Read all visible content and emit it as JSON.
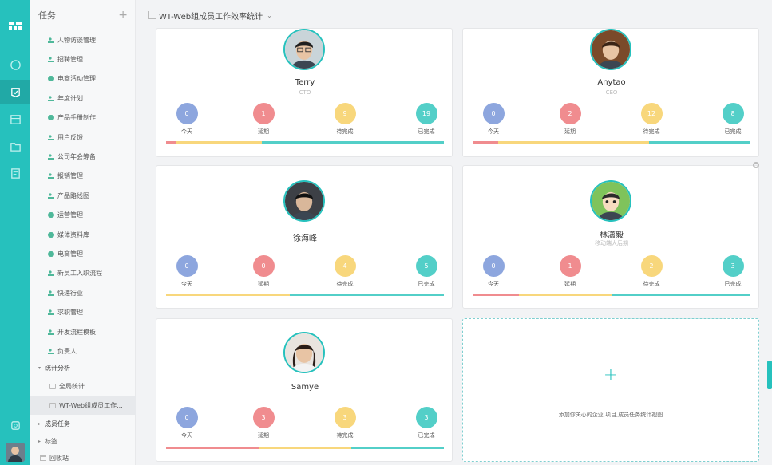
{
  "sidebar": {
    "header": "任务",
    "add": "+",
    "items": [
      {
        "label": "人物访谈管理",
        "icon": "people"
      },
      {
        "label": "招聘管理",
        "icon": "people"
      },
      {
        "label": "电商活动管理",
        "icon": "cloud"
      },
      {
        "label": "年度计划",
        "icon": "people"
      },
      {
        "label": "产品手册制作",
        "icon": "cloud"
      },
      {
        "label": "用户反馈",
        "icon": "people"
      },
      {
        "label": "公司年会筹备",
        "icon": "people"
      },
      {
        "label": "报销管理",
        "icon": "people"
      },
      {
        "label": "产品路线图",
        "icon": "people"
      },
      {
        "label": "运营管理",
        "icon": "cloud"
      },
      {
        "label": "媒体资料库",
        "icon": "cloud"
      },
      {
        "label": "电商管理",
        "icon": "cloud"
      },
      {
        "label": "新员工入职流程",
        "icon": "people"
      },
      {
        "label": "快递行业",
        "icon": "people"
      },
      {
        "label": "求职管理",
        "icon": "people"
      },
      {
        "label": "开发流程模板",
        "icon": "people"
      },
      {
        "label": "负责人",
        "icon": "people"
      }
    ],
    "stats_group": "统计分析",
    "stats_items": [
      "全局统计",
      "WT-Web组成员工作..."
    ],
    "member_tasks": "成员任务",
    "tags": "标签",
    "trash": "回收站"
  },
  "header": {
    "title": "WT-Web组成员工作效率统计",
    "chevron": "⌄"
  },
  "stat_labels": {
    "today": "今天",
    "overdue": "延期",
    "pending": "待完成",
    "done": "已完成"
  },
  "members": [
    {
      "name": "Terry",
      "role": "CTO",
      "today": "0",
      "overdue": "1",
      "pending": "9",
      "done": "19"
    },
    {
      "name": "Anytao",
      "role": "CEO",
      "today": "0",
      "overdue": "2",
      "pending": "12",
      "done": "8"
    },
    {
      "name": "徐海峰",
      "role": "",
      "today": "0",
      "overdue": "0",
      "pending": "4",
      "done": "5"
    },
    {
      "name": "林潇毅",
      "role": "移动端大后期",
      "today": "0",
      "overdue": "1",
      "pending": "2",
      "done": "3"
    },
    {
      "name": "Samye",
      "role": "",
      "today": "0",
      "overdue": "3",
      "pending": "3",
      "done": "3"
    }
  ],
  "add_card": {
    "plus": "+",
    "text": "添加你关心的企业,项目,成员任务统计视图"
  },
  "colors": {
    "accent": "#26c1bd",
    "today": "#8da6de",
    "overdue": "#f08c8f",
    "pending": "#f8d77c",
    "done": "#53cfc8"
  }
}
